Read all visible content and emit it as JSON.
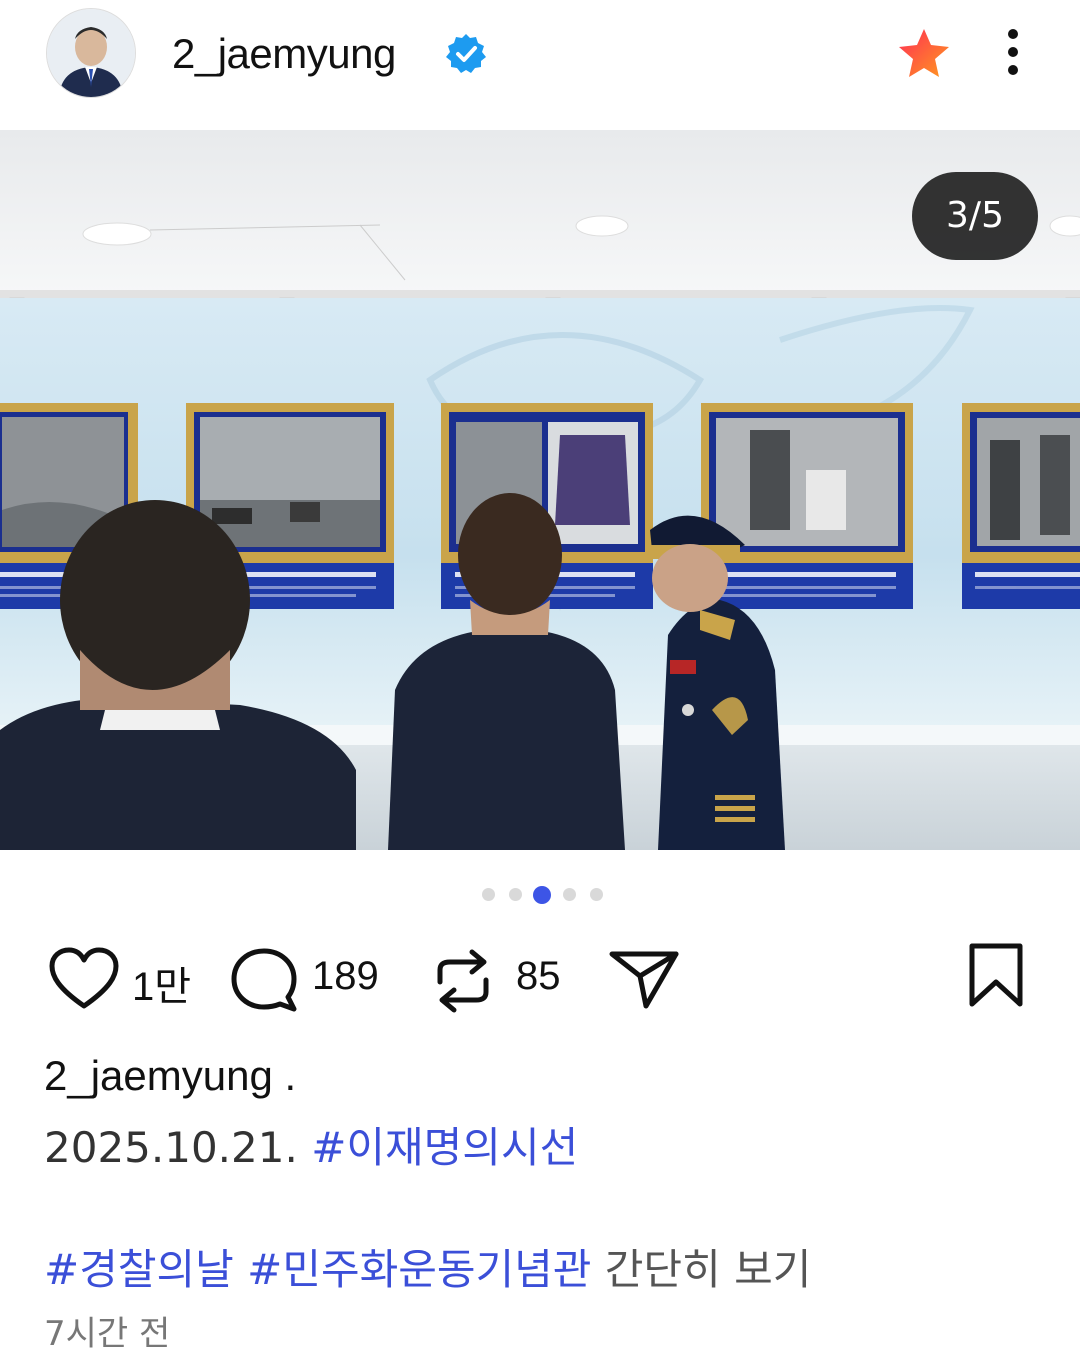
{
  "header": {
    "username": "2_jaemyung"
  },
  "post": {
    "image_counter": "3/5",
    "current_index": 3,
    "total_images": 5
  },
  "actions": {
    "likes": "1만",
    "comments": "189",
    "reposts": "85"
  },
  "caption": {
    "username": "2_jaemyung .",
    "date": "2025.10.21.",
    "hashtag1": "#이재명의시선",
    "hashtag2": "#경찰의날",
    "hashtag3": "#민주화운동기념관",
    "more_label": "간단히 보기",
    "timestamp": "7시간 전"
  },
  "colors": {
    "accent": "#3b4fd8",
    "active_dot": "#3d55e6",
    "verified": "#1d9bf0",
    "star_fill": "#ff4d2d"
  },
  "icons": [
    "avatar",
    "verified-badge-icon",
    "star-icon",
    "more-options-icon",
    "heart-icon",
    "comment-icon",
    "repost-icon",
    "share-icon",
    "bookmark-icon"
  ]
}
